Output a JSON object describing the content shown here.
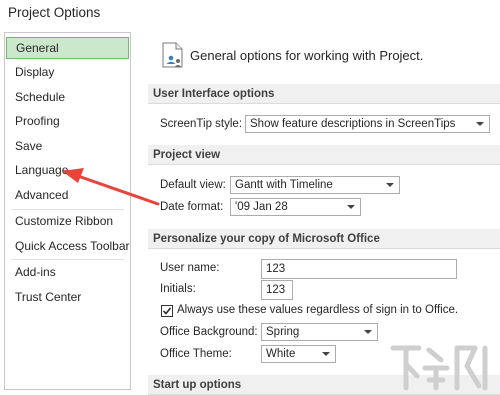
{
  "window": {
    "title": "Project Options"
  },
  "nav": {
    "items": [
      {
        "label": "General"
      },
      {
        "label": "Display"
      },
      {
        "label": "Schedule"
      },
      {
        "label": "Proofing"
      },
      {
        "label": "Save"
      },
      {
        "label": "Language"
      },
      {
        "label": "Advanced"
      },
      {
        "label": "Customize Ribbon"
      },
      {
        "label": "Quick Access Toolbar"
      },
      {
        "label": "Add-ins"
      },
      {
        "label": "Trust Center"
      }
    ],
    "selected_index": 0
  },
  "header": {
    "icon": "general-options-icon",
    "text": "General options for working with Project."
  },
  "ui_options": {
    "heading": "User Interface options",
    "screentip_label": "ScreenTip style:",
    "screentip_value": "Show feature descriptions in ScreenTips"
  },
  "project_view": {
    "heading": "Project view",
    "default_view_label": "Default view:",
    "default_view_value": "Gantt with Timeline",
    "date_format_label": "Date format:",
    "date_format_value": "'09 Jan 28"
  },
  "personalize": {
    "heading": "Personalize your copy of Microsoft Office",
    "user_name_label": "User name:",
    "user_name_value": "123",
    "initials_label": "Initials:",
    "initials_value": "123",
    "always_use_label": "Always use these values regardless of sign in to Office.",
    "always_use_checked": true,
    "office_background_label": "Office Background:",
    "office_background_value": "Spring",
    "office_theme_label": "Office Theme:",
    "office_theme_value": "White"
  },
  "startup": {
    "heading": "Start up options"
  },
  "annotation": {
    "arrow_color": "#e8443a",
    "points_to": "Language"
  },
  "colors": {
    "selected_bg": "#cce8cc",
    "selected_border": "#6fbb6f",
    "section_bg": "#f0f0f0"
  }
}
